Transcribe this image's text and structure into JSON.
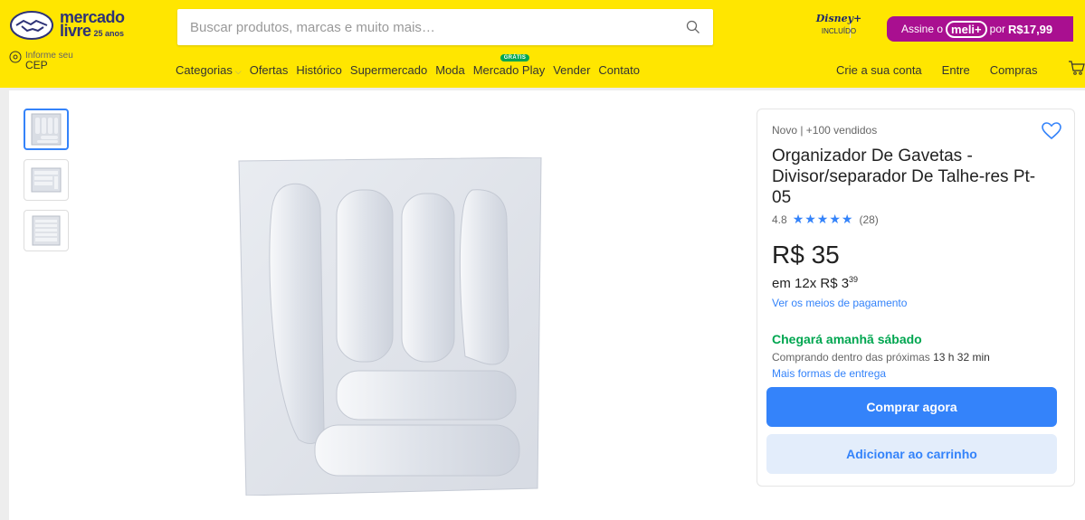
{
  "header": {
    "logo": {
      "line1": "mercado",
      "line2": "livre",
      "badge": "25 anos"
    },
    "search": {
      "placeholder": "Buscar produtos, marcas e muito mais…"
    },
    "disney": {
      "logo_text": "Disney+",
      "sub": "INCLUÍDO"
    },
    "meli_banner": {
      "prefix": "Assine o",
      "pill": "meli+",
      "mid": "por",
      "price": "R$17,99"
    },
    "location": {
      "small": "Informe seu",
      "big": "CEP"
    },
    "nav": [
      {
        "label": "Categorias"
      },
      {
        "label": "Ofertas"
      },
      {
        "label": "Histórico"
      },
      {
        "label": "Supermercado"
      },
      {
        "label": "Moda"
      },
      {
        "label": "Mercado Play",
        "badge": "GRÁTIS"
      },
      {
        "label": "Vender"
      },
      {
        "label": "Contato"
      }
    ],
    "account": [
      {
        "label": "Crie a sua conta"
      },
      {
        "label": "Entre"
      },
      {
        "label": "Compras"
      }
    ],
    "colors": {
      "background": "#ffe600",
      "brand": "#2d3277",
      "meli": "#a90f90"
    }
  },
  "gallery": {
    "thumbnails": [
      {
        "icon": "thumbnail-front-view"
      },
      {
        "icon": "thumbnail-side-view"
      },
      {
        "icon": "thumbnail-top-view"
      }
    ],
    "selected_index": 0
  },
  "product": {
    "condition": "Novo | +100 vendidos",
    "title": "Organizador De Gavetas - Divisor/separador De Talhe-res Pt-05",
    "rating": {
      "score": "4.8",
      "stars": "★★★★★",
      "count": "(28)"
    },
    "price": "R$ 35",
    "installments": {
      "prefix": "em 12x R$ 3",
      "cents": "39"
    },
    "payment_link": "Ver os meios de pagamento",
    "shipping": {
      "arrival": "Chegará amanhã sábado",
      "countdown_prefix": "Comprando dentro das próximas",
      "countdown": "13 h 32 min",
      "more_link": "Mais formas de entrega"
    },
    "buttons": {
      "buy_now": "Comprar agora",
      "add_to_cart": "Adicionar ao carrinho"
    },
    "colors": {
      "primary": "#3483fa",
      "success": "#00a650",
      "secondary_bg": "#e3edfb"
    }
  }
}
